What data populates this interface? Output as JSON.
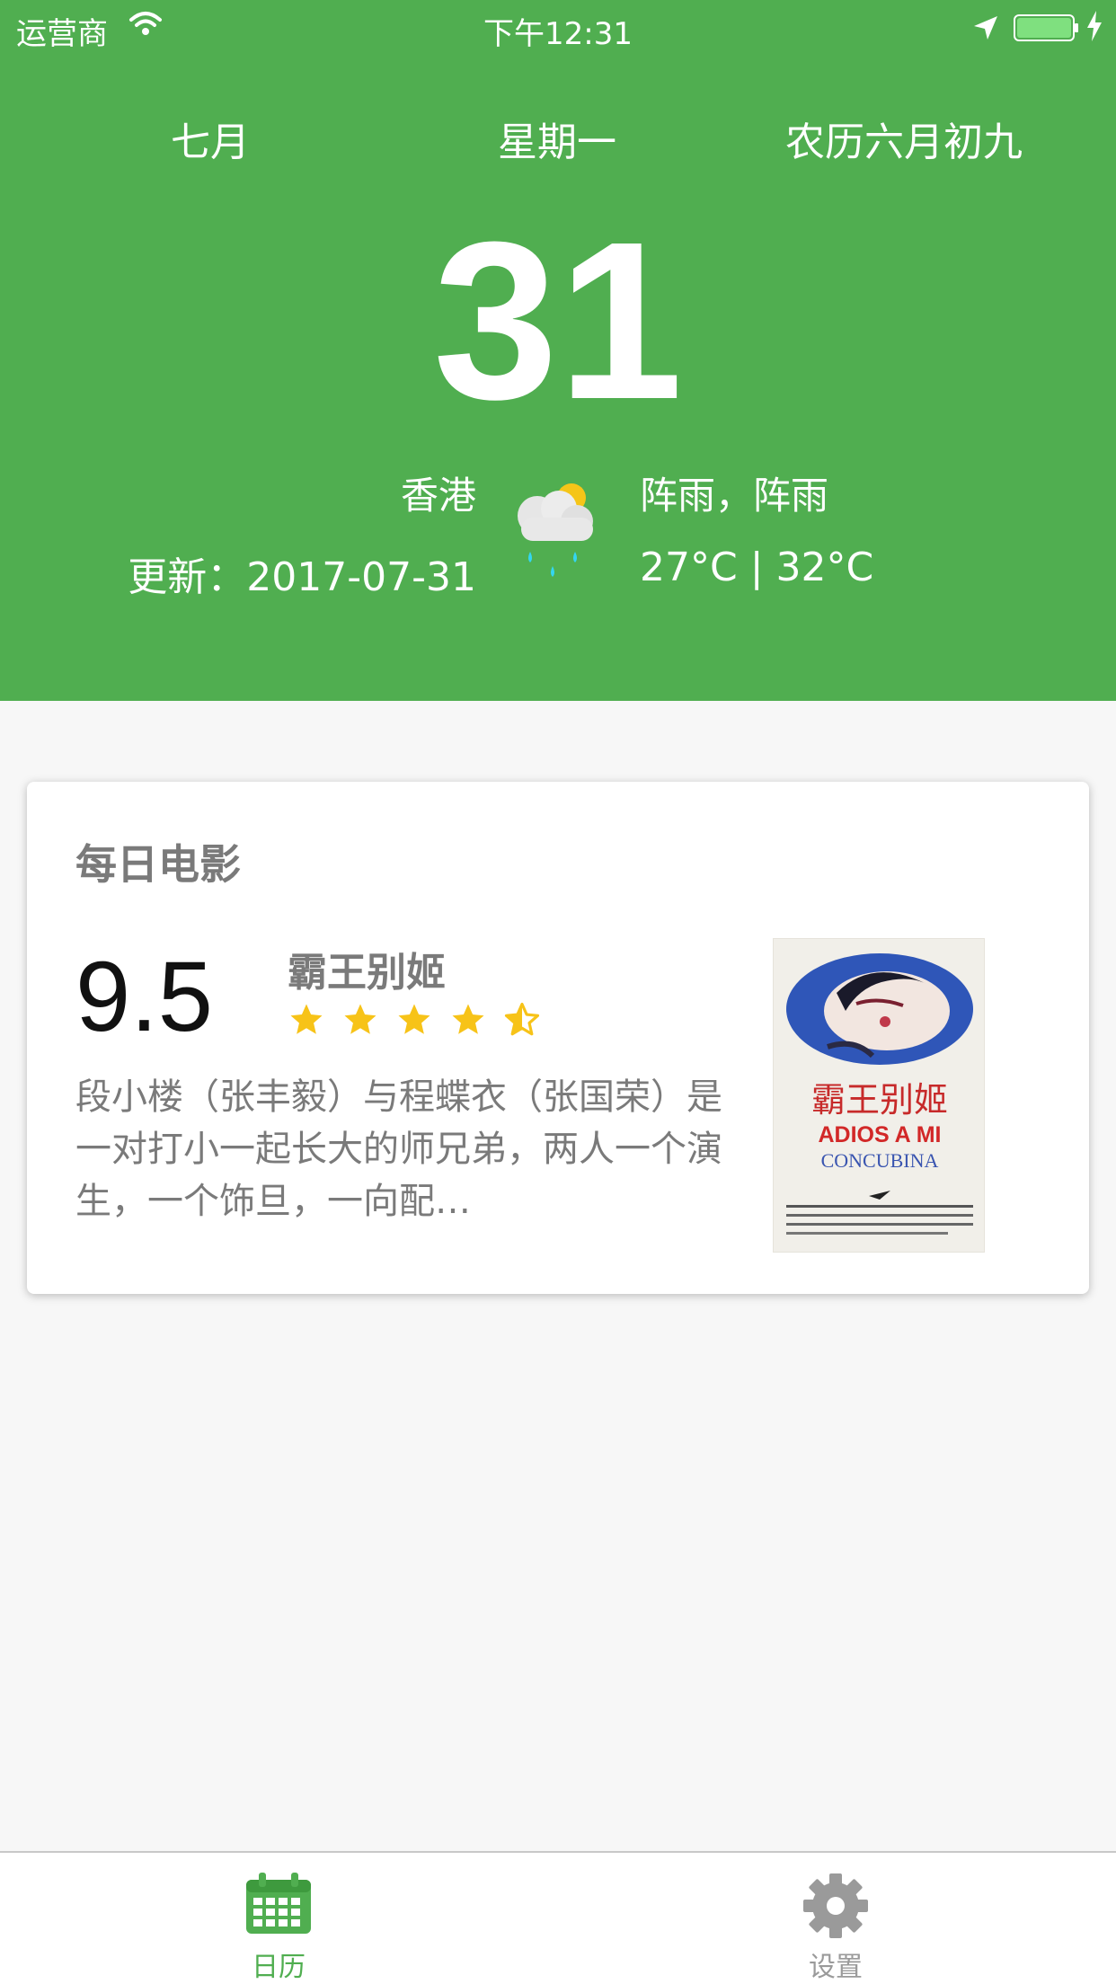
{
  "status_bar": {
    "carrier": "运营商",
    "time": "下午12:31"
  },
  "header": {
    "month": "七月",
    "weekday": "星期一",
    "lunar": "农历六月初九",
    "day": "31",
    "city": "香港",
    "updated": "更新：2017-07-31",
    "condition": "阵雨，阵雨",
    "temperature": "27°C | 32°C",
    "weather_icon": "partly-cloudy-rain-icon",
    "background": "#50ae50"
  },
  "movie_card": {
    "title": "每日电影",
    "score": "9.5",
    "movie_name": "霸王别姬",
    "rating_stars": 4.5,
    "summary": "段小楼（张丰毅）与程蝶衣（张国荣）是一对打小一起长大的师兄弟，两人一个演生，一个饰旦，一向配…",
    "poster": {
      "title_cn": "霸王别姬",
      "title_en_1": "ADIOS A MI",
      "title_en_2": "CONCUBINA"
    }
  },
  "tabs": [
    {
      "label": "日历",
      "icon": "calendar-icon",
      "active": true,
      "color": "#50ae50"
    },
    {
      "label": "设置",
      "icon": "gear-icon",
      "active": false,
      "color": "#9a9a9a"
    }
  ]
}
